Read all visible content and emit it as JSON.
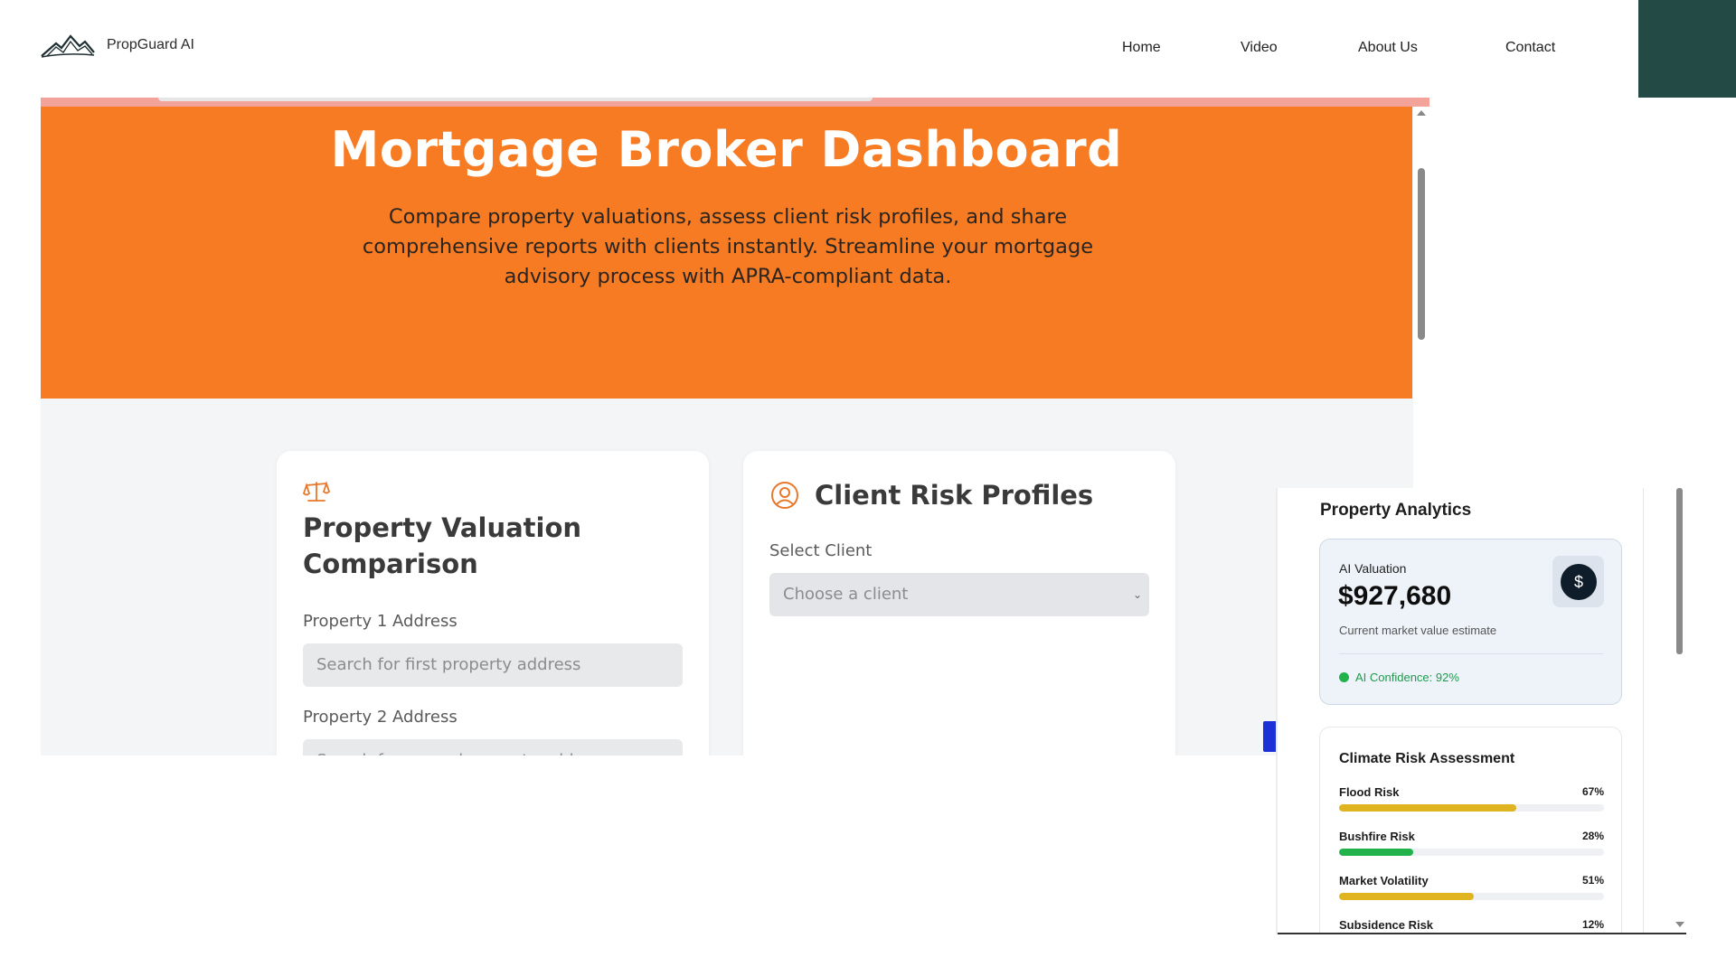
{
  "nav": {
    "brand": "PropGuard AI",
    "links": [
      "Home",
      "Video",
      "About Us",
      "Contact"
    ]
  },
  "hero": {
    "title": "Mortgage Broker Dashboard",
    "description": "Compare property valuations, assess client risk profiles, and share comprehensive reports with clients instantly. Streamline your mortgage advisory process with APRA-compliant data."
  },
  "valuation_card": {
    "title": "Property Valuation Comparison",
    "property1_label": "Property 1 Address",
    "property1_placeholder": "Search for first property address",
    "property2_label": "Property 2 Address",
    "property2_placeholder": "Search for second property address"
  },
  "client_card": {
    "title": "Client Risk Profiles",
    "select_label": "Select Client",
    "select_value": "Choose a client"
  },
  "analytics": {
    "title": "Property Analytics",
    "ai_valuation_label": "AI Valuation",
    "ai_valuation_amount": "$927,680",
    "ai_valuation_sub": "Current market value estimate",
    "ai_confidence": "AI Confidence: 92%",
    "dollar_symbol": "$",
    "climate_title": "Climate Risk Assessment",
    "risks": [
      {
        "name": "Flood Risk",
        "pct_label": "67%",
        "value": 0.67,
        "color": "#e0b320"
      },
      {
        "name": "Bushfire Risk",
        "pct_label": "28%",
        "value": 0.28,
        "color": "#22b24c"
      },
      {
        "name": "Market Volatility",
        "pct_label": "51%",
        "value": 0.51,
        "color": "#e0b320"
      },
      {
        "name": "Subsidence Risk",
        "pct_label": "12%",
        "value": 0.12,
        "color": "#22b24c"
      }
    ]
  },
  "colors": {
    "hero_orange": "#f77b22",
    "brand_dark": "#244a45",
    "accent_blue": "#1d2fd6"
  }
}
